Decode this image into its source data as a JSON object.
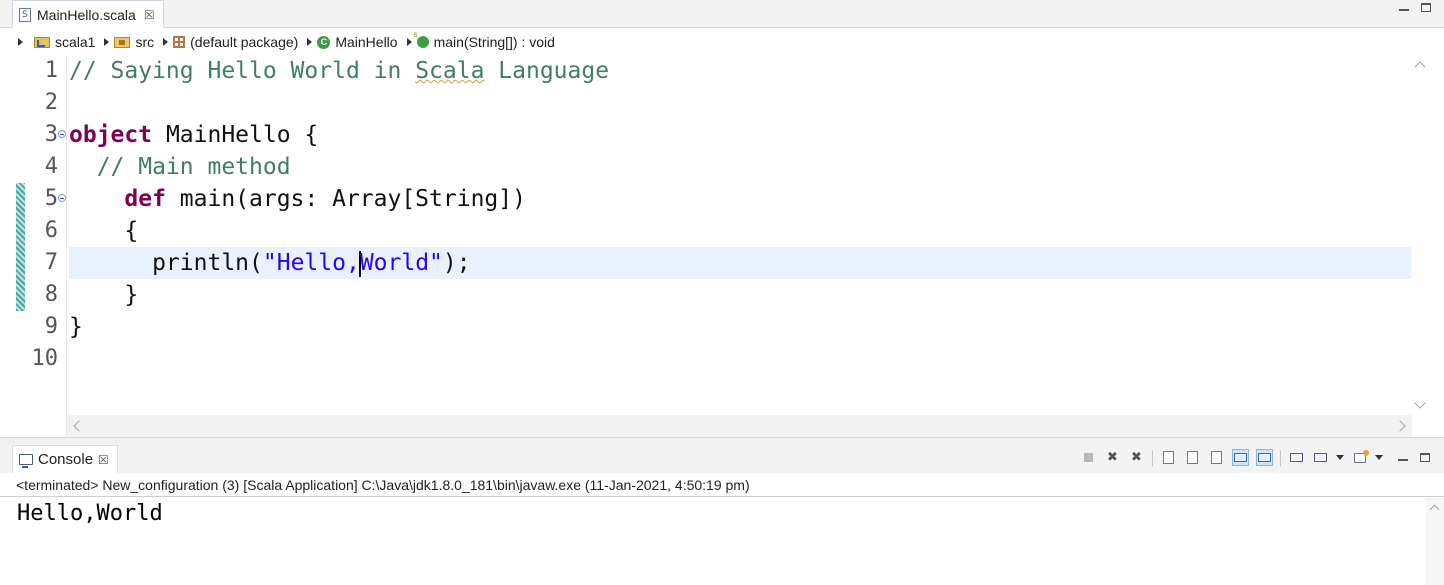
{
  "editor_tab": {
    "file_name": "MainHello.scala",
    "file_icon": "S",
    "close_glyph": "☒"
  },
  "breadcrumb": [
    {
      "label": "scala1",
      "icon": "project-icon"
    },
    {
      "label": "src",
      "icon": "source-folder-icon"
    },
    {
      "label": "(default package)",
      "icon": "package-icon"
    },
    {
      "label": "MainHello",
      "icon": "class-icon",
      "glyph": "C"
    },
    {
      "label": "main(String[]) : void",
      "icon": "method-icon"
    }
  ],
  "code": {
    "line_numbers": [
      "1",
      "2",
      "3",
      "4",
      "5",
      "6",
      "7",
      "8",
      "9",
      "10"
    ],
    "lines": {
      "l1": {
        "comment": "// Saying Hello World in ",
        "squiggle": "Scala",
        "rest": " Language"
      },
      "l3": {
        "kw": "object",
        "rest": " MainHello {"
      },
      "l4": {
        "comment": "  // Main method"
      },
      "l5": {
        "indent": "    ",
        "kw": "def",
        "rest": " main(args: Array[String])"
      },
      "l6": {
        "text": "    {"
      },
      "l7": {
        "pre": "      println(",
        "str_a": "\"Hello,",
        "str_b": "World\"",
        "post": ");"
      },
      "l8": {
        "text": "    }"
      },
      "l9": {
        "text": "}"
      }
    },
    "current_line": 7
  },
  "console": {
    "tab_label": "Console",
    "close_glyph": "☒",
    "status": "<terminated> New_configuration (3) [Scala Application] C:\\Java\\jdk1.8.0_181\\bin\\javaw.exe (11-Jan-2021, 4:50:19 pm)",
    "output": "Hello,World"
  },
  "colors": {
    "comment": "#3f7f5f",
    "keyword": "#7f0055",
    "string": "#2a00ff",
    "current_line_bg": "#e8f2fe"
  }
}
